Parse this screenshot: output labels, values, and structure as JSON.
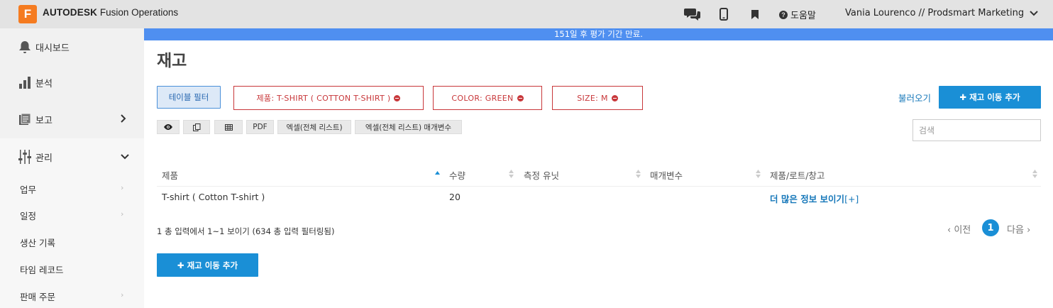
{
  "app": {
    "logo_letter": "F",
    "brand_bold": "AUTODESK",
    "brand_rest": "Fusion Operations"
  },
  "topbar": {
    "help_label": "도움말",
    "user_label": "Vania Lourenco // Prodsmart Marketing"
  },
  "sidebar": {
    "items": [
      {
        "label": "대시보드"
      },
      {
        "label": "분석"
      },
      {
        "label": "보고"
      },
      {
        "label": "관리"
      }
    ],
    "sub_items": [
      {
        "label": "업무"
      },
      {
        "label": "일정"
      },
      {
        "label": "생산 기록"
      },
      {
        "label": "타임 레코드"
      },
      {
        "label": "판매 주문"
      }
    ]
  },
  "banner": {
    "text": "151일 후 평가 기간 만료."
  },
  "page": {
    "title": "재고"
  },
  "filters": {
    "table_filter_label": "테이블 필터",
    "chips": [
      {
        "label": "제품: T-SHIRT ( COTTON T-SHIRT )"
      },
      {
        "label": "COLOR: GREEN"
      },
      {
        "label": "SIZE: M"
      }
    ],
    "load_label": "불러오기",
    "add_movement_label": "재고 이동 추가"
  },
  "toolbar": {
    "pdf_label": "PDF",
    "excel_label": "엑셀(전체 리스트)",
    "excel_params_label": "엑셀(전체 리스트) 매개변수"
  },
  "search": {
    "placeholder": "검색"
  },
  "table": {
    "columns": [
      "제품",
      "수량",
      "측정 유닛",
      "매개변수",
      "제품/로트/창고"
    ],
    "rows": [
      {
        "product": "T-shirt ( Cotton T-shirt )",
        "quantity": "20",
        "unit": "",
        "params": "",
        "more": "더 많은 정보 보이기",
        "more_suffix": "[+]"
      }
    ]
  },
  "footer": {
    "info": "1 총 입력에서 1~1 보이기 (634 총 입력 필터링됨)",
    "prev_label": "이전",
    "current_page": "1",
    "next_label": "다음",
    "add_movement_label": "재고 이동 추가"
  },
  "colors": {
    "accent": "#1a8fd6",
    "banner": "#4f8ff0",
    "danger": "#c8373a",
    "logo": "#f57b20",
    "link": "#1577b9"
  }
}
